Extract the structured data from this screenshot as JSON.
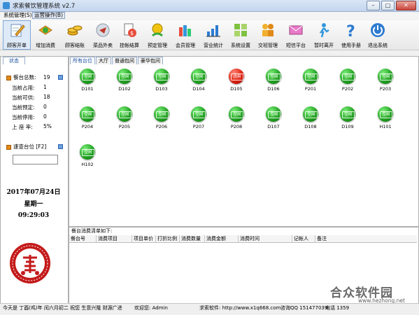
{
  "window": {
    "title": "求索餐饮管理系统 v2.7",
    "btn_min": "–",
    "btn_max": "□",
    "btn_close": "✕"
  },
  "menu": [
    {
      "label": "系统管理(S)",
      "active": false
    },
    {
      "label": "运营操作(B)",
      "active": true
    }
  ],
  "toolbar": [
    {
      "label": "顾客开单",
      "icon": "order-pen-icon",
      "selected": true
    },
    {
      "label": "增加消费",
      "icon": "add-consumption-icon"
    },
    {
      "label": "顾客结账",
      "icon": "coins-checkout-icon"
    },
    {
      "label": "菜品外卖",
      "icon": "takeaway-icon"
    },
    {
      "label": "挂帐结算",
      "icon": "credit-settle-icon"
    },
    {
      "label": "预定管理",
      "icon": "reservation-icon"
    },
    {
      "label": "会员管理",
      "icon": "member-icon"
    },
    {
      "label": "营业统计",
      "icon": "statistics-icon"
    },
    {
      "label": "系统设置",
      "icon": "settings-icon"
    },
    {
      "label": "交班管理",
      "icon": "shift-handover-icon"
    },
    {
      "label": "短信平台",
      "icon": "sms-icon"
    },
    {
      "label": "暂时离开",
      "icon": "away-icon"
    },
    {
      "label": "使用手册",
      "icon": "manual-icon"
    },
    {
      "label": "退出系统",
      "icon": "power-icon"
    }
  ],
  "left": {
    "tab": "状态",
    "stats_title": "餐台总数:",
    "stats_total": "19",
    "stats": [
      {
        "label": "当前占用:",
        "value": "1"
      },
      {
        "label": "当前可供:",
        "value": "18"
      },
      {
        "label": "当前预定:",
        "value": "0"
      },
      {
        "label": "当前停用:",
        "value": "0"
      },
      {
        "label": "上 座 率:",
        "value": "5%"
      }
    ],
    "quick_title": "速查台位 [F2]",
    "quick_value": "",
    "date": "2017年07月24日",
    "weekday": "星期一",
    "time": "09:29:03"
  },
  "tabs": [
    {
      "label": "所有台位",
      "active": true
    },
    {
      "label": "大厅"
    },
    {
      "label": "普通包间"
    },
    {
      "label": "豪华包间"
    }
  ],
  "status_labels": {
    "free": "空闲",
    "occupied": "占用"
  },
  "tables": [
    {
      "name": "D101",
      "status": "free"
    },
    {
      "name": "D102",
      "status": "free"
    },
    {
      "name": "D103",
      "status": "free"
    },
    {
      "name": "D104",
      "status": "free"
    },
    {
      "name": "D105",
      "status": "occupied"
    },
    {
      "name": "D106",
      "status": "free"
    },
    {
      "name": "P201",
      "status": "free"
    },
    {
      "name": "P202",
      "status": "free"
    },
    {
      "name": "P203",
      "status": "free"
    },
    {
      "name": "P204",
      "status": "free"
    },
    {
      "name": "P205",
      "status": "free"
    },
    {
      "name": "P206",
      "status": "free"
    },
    {
      "name": "P207",
      "status": "free"
    },
    {
      "name": "P208",
      "status": "free"
    },
    {
      "name": "D107",
      "status": "free"
    },
    {
      "name": "D108",
      "status": "free"
    },
    {
      "name": "D109",
      "status": "free"
    },
    {
      "name": "H101",
      "status": "free"
    },
    {
      "name": "H102",
      "status": "free"
    }
  ],
  "orders": {
    "title": "餐台消费清单如下:",
    "columns": [
      "餐台号",
      "消费项目",
      "项目单价",
      "打折比例",
      "消费数量",
      "消费金额",
      "消费时间",
      "记帐人",
      "备注"
    ]
  },
  "statusbar": {
    "date_info": "今天是 丁酉(鸡)年 闰六月初二 祝您 生意兴隆 财源广进",
    "welcome": "欢迎您: Admin",
    "software": "求索软件: http://www.x1q668.com",
    "qq": "咨询QQ 151477039",
    "phone": "电话 1359"
  },
  "watermark": {
    "brand": "合众软件园",
    "url": "www.hezhong.net"
  },
  "colors": {
    "accent": "#1a4fa0",
    "free": "#22a322",
    "occupied": "#e02010",
    "seal": "#c41a1a"
  }
}
